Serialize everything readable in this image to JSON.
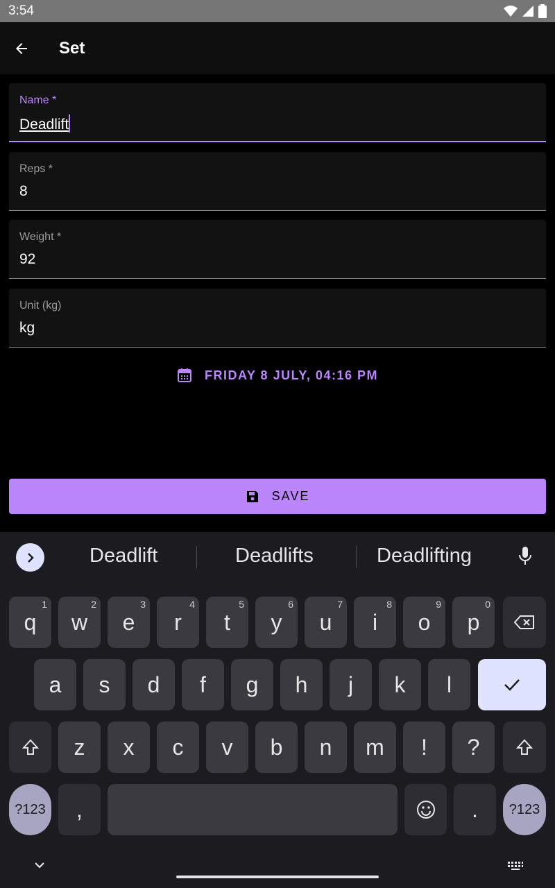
{
  "status_bar": {
    "time": "3:54"
  },
  "app_bar": {
    "title": "Set"
  },
  "form": {
    "name": {
      "label": "Name *",
      "value": "Deadlift"
    },
    "reps": {
      "label": "Reps *",
      "value": "8"
    },
    "weight": {
      "label": "Weight *",
      "value": "92"
    },
    "unit": {
      "label": "Unit (kg)",
      "value": "kg"
    },
    "date_button": "FRIDAY 8 JULY, 04:16 PM",
    "save_button": "SAVE"
  },
  "keyboard": {
    "suggestions": [
      "Deadlift",
      "Deadlifts",
      "Deadlifting"
    ],
    "row1": [
      {
        "k": "q",
        "h": "1"
      },
      {
        "k": "w",
        "h": "2"
      },
      {
        "k": "e",
        "h": "3"
      },
      {
        "k": "r",
        "h": "4"
      },
      {
        "k": "t",
        "h": "5"
      },
      {
        "k": "y",
        "h": "6"
      },
      {
        "k": "u",
        "h": "7"
      },
      {
        "k": "i",
        "h": "8"
      },
      {
        "k": "o",
        "h": "9"
      },
      {
        "k": "p",
        "h": "0"
      }
    ],
    "row2": [
      "a",
      "s",
      "d",
      "f",
      "g",
      "h",
      "j",
      "k",
      "l"
    ],
    "row3": [
      "z",
      "x",
      "c",
      "v",
      "b",
      "n",
      "m",
      "!",
      "?"
    ],
    "symbols_label": "?123",
    "comma": ",",
    "period": "."
  },
  "colors": {
    "accent": "#bb86fc",
    "keyboard_bg": "#1c1b20",
    "key_bg": "#3b3a40"
  },
  "icons": [
    "back-arrow-icon",
    "wifi-icon",
    "signal-icon",
    "battery-icon",
    "calendar-icon",
    "save-disk-icon",
    "chevron-right-icon",
    "microphone-icon",
    "backspace-icon",
    "checkmark-icon",
    "shift-icon",
    "emoji-icon",
    "chevron-down-icon",
    "keyboard-icon"
  ]
}
